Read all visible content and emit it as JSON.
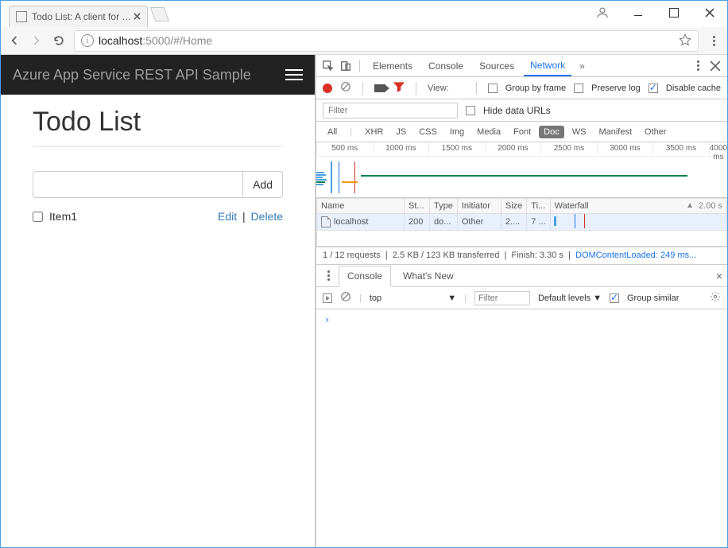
{
  "window": {
    "tab_title": "Todo List: A client for sample",
    "url_host": "localhost",
    "url_port": ":5000",
    "url_path": "/#/Home"
  },
  "page": {
    "header_brand": "Azure App Service REST API Sample",
    "heading": "Todo List",
    "add_button": "Add",
    "items": [
      {
        "label": "Item1",
        "edit": "Edit",
        "delete": "Delete"
      }
    ]
  },
  "devtools": {
    "tabs": {
      "elements": "Elements",
      "console": "Console",
      "sources": "Sources",
      "network": "Network"
    },
    "toolbar": {
      "view_label": "View:",
      "group_by_frame": "Group by frame",
      "preserve_log": "Preserve log",
      "disable_cache": "Disable cache"
    },
    "filter_placeholder": "Filter",
    "hide_data_urls": "Hide data URLs",
    "types": {
      "all": "All",
      "xhr": "XHR",
      "js": "JS",
      "css": "CSS",
      "img": "Img",
      "media": "Media",
      "font": "Font",
      "doc": "Doc",
      "ws": "WS",
      "manifest": "Manifest",
      "other": "Other"
    },
    "timeline_ticks": [
      "500 ms",
      "1000 ms",
      "1500 ms",
      "2000 ms",
      "2500 ms",
      "3000 ms",
      "3500 ms",
      "4000 ms"
    ],
    "columns": {
      "name": "Name",
      "status": "St...",
      "type": "Type",
      "initiator": "Initiator",
      "size": "Size",
      "time": "Ti...",
      "waterfall": "Waterfall",
      "wf_scale": "2.00 s"
    },
    "rows": [
      {
        "name": "localhost",
        "status": "200",
        "type": "do...",
        "initiator": "Other",
        "size": "2....",
        "time": "7 ..."
      }
    ],
    "footer": {
      "requests": "1 / 12 requests",
      "transferred": "2.5 KB / 123 KB transferred",
      "finish": "Finish: 3.30 s",
      "dcl": "DOMContentLoaded: 249 ms..."
    },
    "drawer": {
      "console": "Console",
      "whatsnew": "What's New"
    },
    "console_toolbar": {
      "context": "top",
      "filter": "Filter",
      "levels": "Default levels",
      "group_similar": "Group similar"
    }
  }
}
